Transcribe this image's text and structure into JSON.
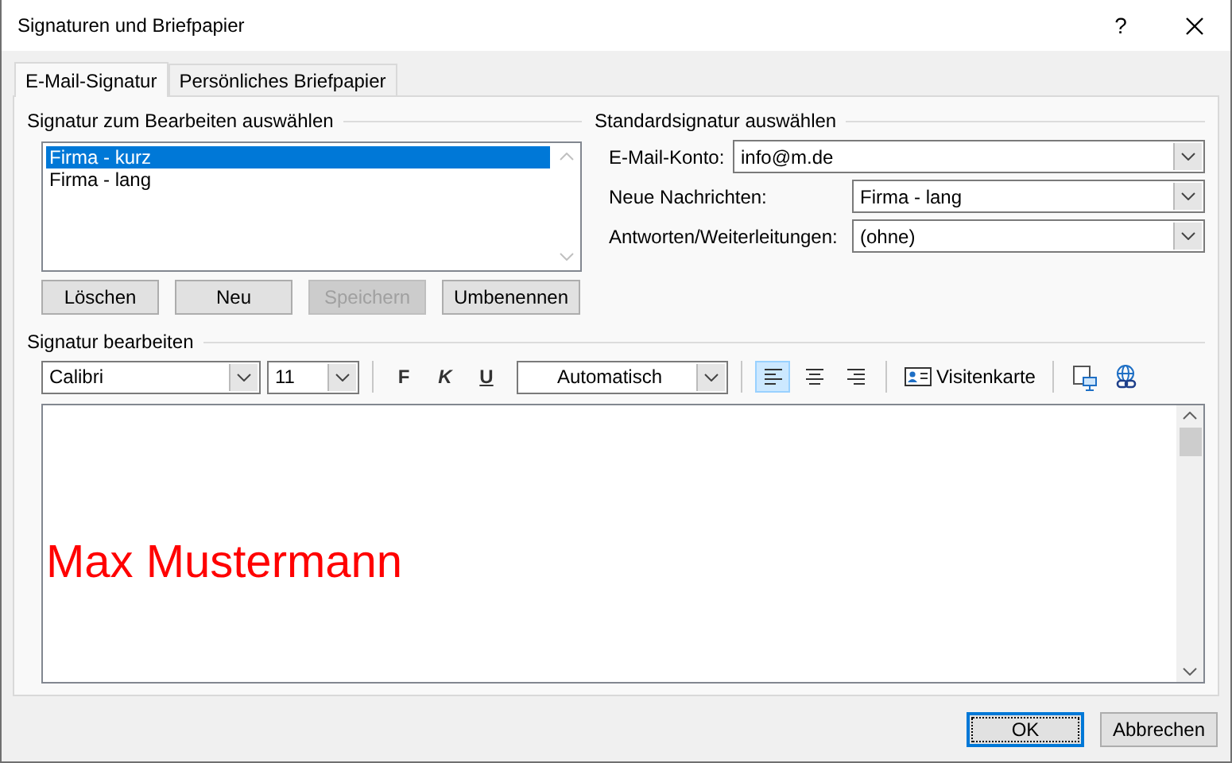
{
  "window": {
    "title": "Signaturen und Briefpapier",
    "help_button": "?"
  },
  "tabs": [
    {
      "label": "E-Mail-Signatur",
      "selected": true
    },
    {
      "label": "Persönliches Briefpapier",
      "selected": false
    }
  ],
  "signature_list": {
    "heading": "Signatur zum Bearbeiten auswählen",
    "items": [
      {
        "label": "Firma - kurz",
        "selected": true
      },
      {
        "label": "Firma - lang",
        "selected": false
      }
    ],
    "buttons": [
      {
        "label": "Löschen",
        "disabled": false
      },
      {
        "label": "Neu",
        "disabled": false
      },
      {
        "label": "Speichern",
        "disabled": true
      },
      {
        "label": "Umbenennen",
        "disabled": false
      }
    ]
  },
  "default_signature": {
    "heading": "Standardsignatur auswählen",
    "fields": [
      {
        "kind": "wide",
        "label": "E-Mail-Konto:",
        "value": "info@m.de"
      },
      {
        "kind": "narrow",
        "label": "Neue Nachrichten:",
        "value": "Firma - lang"
      },
      {
        "kind": "narrow",
        "label": "Antworten/Weiterleitungen:",
        "value": "(ohne)"
      }
    ]
  },
  "editor": {
    "heading": "Signatur bearbeiten",
    "font": "Calibri",
    "size": "11",
    "bold": "F",
    "italic": "K",
    "underline": "U",
    "font_color": "Automatisch",
    "alignments": [
      {
        "kind": "left",
        "selected": true
      },
      {
        "kind": "center",
        "selected": false
      },
      {
        "kind": "right",
        "selected": false
      }
    ],
    "business_card": "Visitenkarte",
    "content": "Max Mustermann"
  },
  "buttons": [
    {
      "label": "OK",
      "default": true
    },
    {
      "label": "Abbrechen",
      "default": false
    }
  ]
}
